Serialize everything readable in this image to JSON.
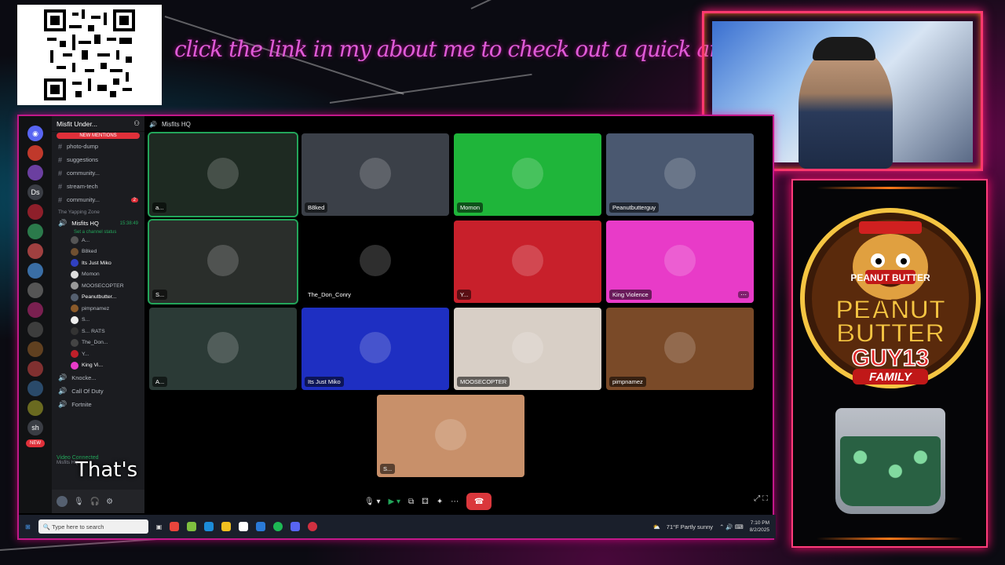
{
  "banner": "click the link in my about me to check out a quick an easy come up!",
  "discord": {
    "server_name": "Misfit Under...",
    "new_mentions": "NEW MENTIONS",
    "channel_title": "Misfits HQ",
    "text_channels": [
      {
        "name": "photo-dump",
        "badge": ""
      },
      {
        "name": "suggestions",
        "badge": ""
      },
      {
        "name": "community...",
        "badge": ""
      },
      {
        "name": "stream-tech",
        "badge": ""
      },
      {
        "name": "community...",
        "badge": "2"
      }
    ],
    "voice_category": "The Yapping Zone",
    "active_channel": "Misfits HQ",
    "active_time": "15:38:49",
    "set_status": "Set a channel status",
    "voice_users": [
      "A...",
      "B8ked",
      "Its Just Miko",
      "Momon",
      "MOOSECOPTER",
      "Peanutbutter...",
      "pimpnamez",
      "S...",
      "S... RATS",
      "The_Don...",
      "Y...",
      "King Vi..."
    ],
    "other_channels": [
      "Knocke...",
      "Call Of Duty",
      "Fortnite"
    ],
    "voice_connected": "Video Connected",
    "voice_sub": "Misfits HQ",
    "server_icons": [
      "Ds",
      "sh"
    ],
    "new_badge": "NEW"
  },
  "tiles": [
    {
      "label": "a...",
      "bg": "#1e2a22",
      "speaking": true
    },
    {
      "label": "B8ked",
      "bg": "#3b4048",
      "speaking": false
    },
    {
      "label": "Momon",
      "bg": "#1fb53a",
      "speaking": false
    },
    {
      "label": "Peanutbutterguy",
      "bg": "#4a5870",
      "speaking": false
    },
    {
      "label": "S...",
      "bg": "#2a2e2b",
      "speaking": true
    },
    {
      "label": "The_Don_Conry",
      "bg": "#000000",
      "speaking": false
    },
    {
      "label": "Y...",
      "bg": "#c8202b",
      "speaking": false
    },
    {
      "label": "King Violence",
      "bg": "#e83bc8",
      "speaking": false
    },
    {
      "label": "A...",
      "bg": "#2b3a36",
      "speaking": false
    },
    {
      "label": "Its Just Miko",
      "bg": "#1e2fc2",
      "speaking": false
    },
    {
      "label": "MOOSECOPTER",
      "bg": "#d8cfc6",
      "speaking": false
    },
    {
      "label": "pimpnamez",
      "bg": "#7a4a28",
      "speaking": false
    },
    {
      "label": "S...",
      "bg": "#c8906a",
      "speaking": false
    }
  ],
  "taskbar": {
    "search_placeholder": "Type here to search",
    "weather": "71°F  Partly sunny",
    "time": "7:10 PM",
    "date": "8/2/2025"
  },
  "caption": "That's",
  "logo": {
    "line1": "PEANUT",
    "line2": "BUTTER",
    "line3": "GUY13",
    "line4": "FAMILY",
    "jar_label": "PEANUT BUTTER"
  }
}
